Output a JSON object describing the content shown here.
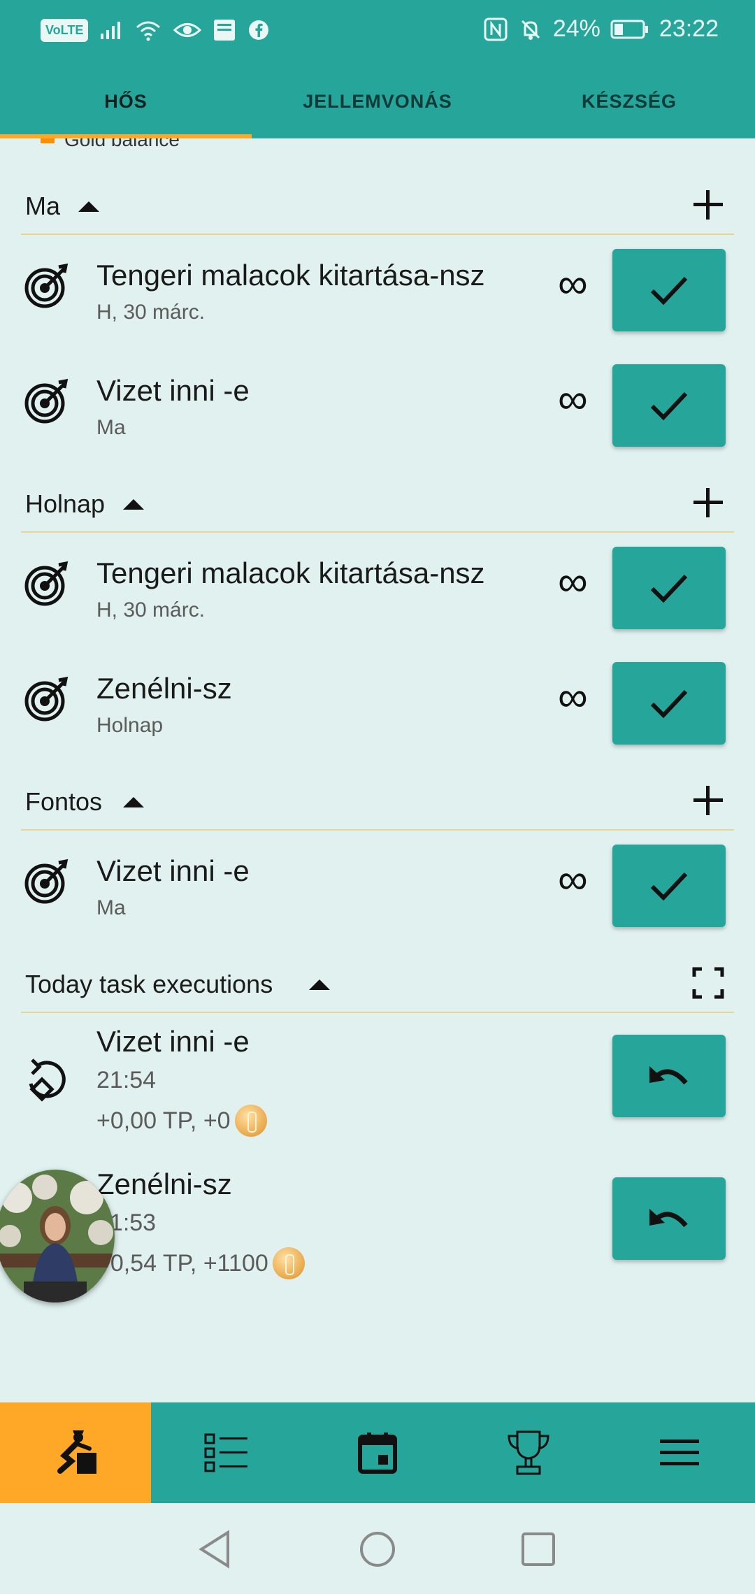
{
  "status_bar": {
    "volte": "VoLTE",
    "battery_percent": "24%",
    "time": "23:22"
  },
  "tabs": [
    {
      "label": "HŐS",
      "active": true
    },
    {
      "label": "JELLEMVONÁS",
      "active": false
    },
    {
      "label": "KÉSZSÉG",
      "active": false
    }
  ],
  "peek_text": "Gold balance",
  "sections": [
    {
      "title": "Ma",
      "action_icon": "plus-icon",
      "items": [
        {
          "title": "Tengeri malacok kitartása-nsz",
          "subtitle": "H, 30 márc.",
          "repeat": "∞"
        },
        {
          "title": "Vizet inni -e",
          "subtitle": "Ma",
          "repeat": "∞"
        }
      ]
    },
    {
      "title": "Holnap",
      "action_icon": "plus-icon",
      "items": [
        {
          "title": "Tengeri malacok kitartása-nsz",
          "subtitle": "H, 30 márc.",
          "repeat": "∞"
        },
        {
          "title": "Zenélni-sz",
          "subtitle": "Holnap",
          "repeat": "∞"
        }
      ]
    },
    {
      "title": "Fontos",
      "action_icon": "plus-icon",
      "items": [
        {
          "title": "Vizet inni -e",
          "subtitle": "Ma",
          "repeat": "∞"
        }
      ]
    },
    {
      "title": "Today task executions",
      "action_icon": "fullscreen-icon",
      "items": [
        {
          "title": "Vizet inni -e",
          "time": "21:54",
          "reward": "+0,00 TP, +0"
        },
        {
          "title": "Zenélni-sz",
          "time": "21:53",
          "reward": "+0,54 TP, +1100"
        }
      ]
    }
  ],
  "bottom_nav": [
    {
      "icon": "hero-icon",
      "active": true
    },
    {
      "icon": "list-icon",
      "active": false
    },
    {
      "icon": "calendar-icon",
      "active": false
    },
    {
      "icon": "trophy-icon",
      "active": false
    },
    {
      "icon": "menu-icon",
      "active": false
    }
  ],
  "colors": {
    "primary": "#26a69a",
    "accent": "#ffa726",
    "background": "#e0f1f0",
    "divider": "#e8d594"
  }
}
